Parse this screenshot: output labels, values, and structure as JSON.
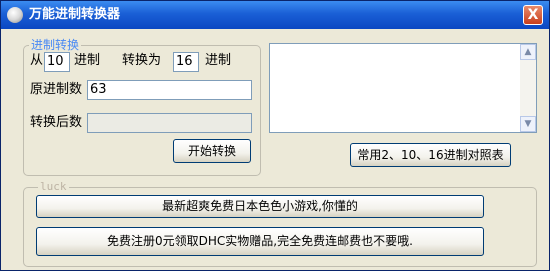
{
  "window": {
    "title": "万能进制转换器",
    "close_glyph": "X"
  },
  "converter": {
    "group_label": "进制转换",
    "from_prefix": "从",
    "from_base": "10",
    "from_suffix": "进制",
    "to_prefix": "转换为",
    "to_base": "16",
    "to_suffix": "进制",
    "source_label": "原进制数",
    "source_value": "63",
    "result_label": "转换后数",
    "result_value": "",
    "start_button": "开始转换"
  },
  "reference_button": "常用2、10、16进制对照表",
  "luck": {
    "group_label": "luck",
    "button1": "最新超爽免费日本色色小游戏,你懂的",
    "button2": "免费注册0元领取DHC实物赠品,完全免费连邮费也不要哦."
  },
  "scroll": {
    "up_glyph": "▲",
    "down_glyph": "▼"
  }
}
